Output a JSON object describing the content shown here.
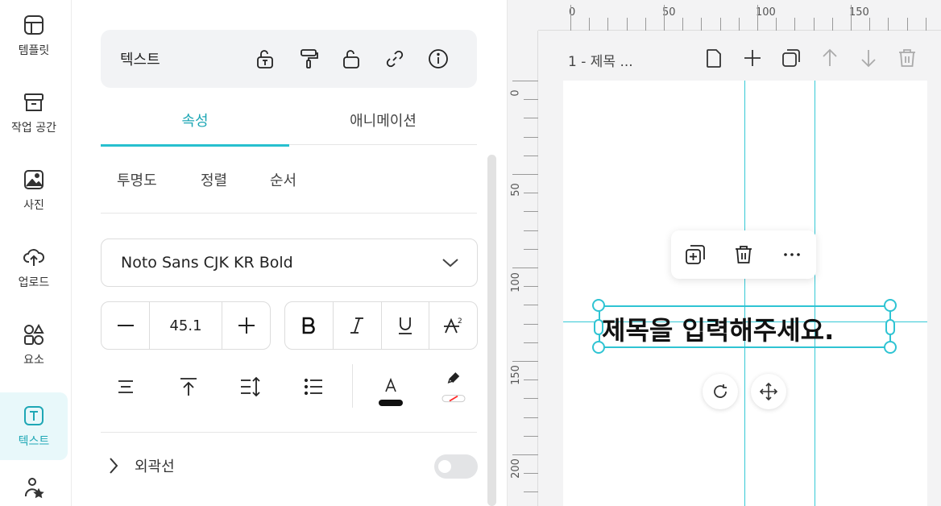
{
  "nav": {
    "items": [
      {
        "label": "템플릿",
        "icon": "template-icon"
      },
      {
        "label": "작업 공간",
        "icon": "archive-box-icon"
      },
      {
        "label": "사진",
        "icon": "image-icon"
      },
      {
        "label": "업로드",
        "icon": "cloud-upload-icon"
      },
      {
        "label": "요소",
        "icon": "shapes-icon"
      },
      {
        "label": "텍스트",
        "icon": "text-icon",
        "active": true
      },
      {
        "label": "",
        "icon": "person-star-icon"
      }
    ]
  },
  "panel": {
    "title": "텍스트",
    "tabs": [
      {
        "label": "속성",
        "active": true
      },
      {
        "label": "애니메이션",
        "active": false
      }
    ],
    "subtabs": [
      "투명도",
      "정렬",
      "순서"
    ],
    "font": {
      "value": "Noto Sans CJK KR Bold"
    },
    "font_size": {
      "value": "45.1"
    },
    "outline": {
      "label": "외곽선",
      "enabled": false
    }
  },
  "canvas": {
    "page_name": "1 - 제목 ...",
    "ruler_top": [
      "0",
      "50",
      "100",
      "150"
    ],
    "ruler_left": [
      "0",
      "50",
      "100",
      "150",
      "200"
    ],
    "text_content": "제목을 입력해주세요."
  },
  "colors": {
    "accent": "#27c0cf",
    "active_nav_bg": "#e8f8fa",
    "text_color_swatch": "#111111",
    "highlight_swatch": "#ff2a2a"
  }
}
